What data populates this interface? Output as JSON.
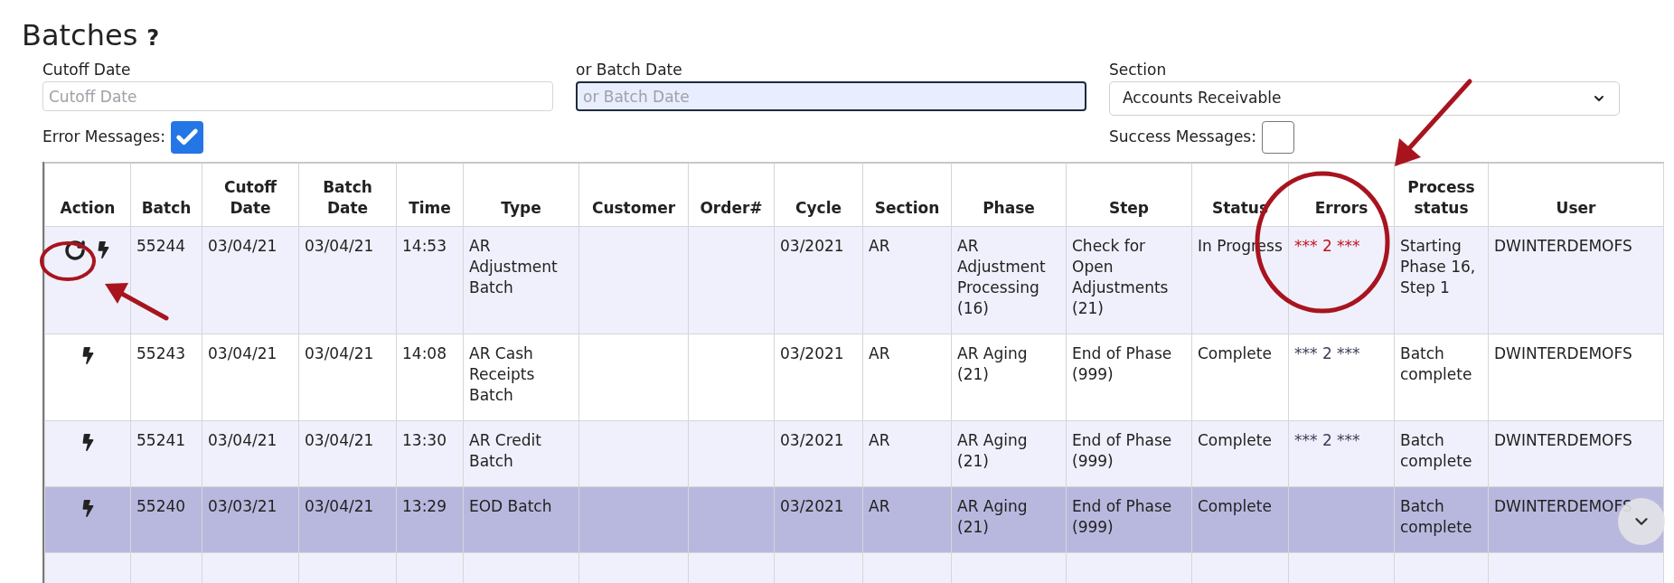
{
  "page": {
    "title": "Batches",
    "help": "?"
  },
  "filters": [
    {
      "kind": "date",
      "label": "Cutoff Date",
      "placeholder": "Cutoff Date",
      "focused": false
    },
    {
      "kind": "date",
      "label": "or Batch Date",
      "placeholder": "or Batch Date",
      "focused": true
    },
    {
      "kind": "select",
      "label": "Section",
      "value": "Accounts Receivable"
    }
  ],
  "options": [
    {
      "label": "Error Messages:",
      "checked": true
    },
    {
      "label": "Success Messages:",
      "checked": false
    }
  ],
  "table": {
    "columns": [
      "Action",
      "Batch",
      "Cutoff Date",
      "Batch Date",
      "Time",
      "Type",
      "Customer",
      "Order#",
      "Cycle",
      "Section",
      "Phase",
      "Step",
      "Status",
      "Errors",
      "Process status",
      "User"
    ],
    "rows": [
      {
        "selected": false,
        "actions": [
          {
            "kind": "refresh"
          },
          {
            "kind": "run"
          }
        ],
        "color": "#c0141c",
        "cells": [
          "",
          "55244",
          "03/04/21",
          "03/04/21",
          "14:53",
          "AR Adjustment Batch",
          "",
          "",
          "03/2021",
          "AR",
          "AR Adjustment Processing (16)",
          "Check for Open Adjustments (21)",
          "In Progress",
          "*** 2 ***",
          "Starting Phase 16, Step 1",
          "DWINTERDEMOFS"
        ]
      },
      {
        "selected": false,
        "actions": [
          {
            "kind": "run"
          }
        ],
        "color": "#3a3f55",
        "cells": [
          "",
          "55243",
          "03/04/21",
          "03/04/21",
          "14:08",
          "AR Cash Receipts Batch",
          "",
          "",
          "03/2021",
          "AR",
          "AR Aging (21)",
          "End of Phase (999)",
          "Complete",
          "*** 2 ***",
          "Batch complete",
          "DWINTERDEMOFS"
        ]
      },
      {
        "selected": false,
        "actions": [
          {
            "kind": "run"
          }
        ],
        "color": "#3a3f55",
        "cells": [
          "",
          "55241",
          "03/04/21",
          "03/04/21",
          "13:30",
          "AR Credit Batch",
          "",
          "",
          "03/2021",
          "AR",
          "AR Aging (21)",
          "End of Phase (999)",
          "Complete",
          "*** 2 ***",
          "Batch complete",
          "DWINTERDEMOFS"
        ]
      },
      {
        "selected": true,
        "actions": [
          {
            "kind": "run"
          }
        ],
        "cells": [
          "",
          "55240",
          "03/03/21",
          "03/04/21",
          "13:29",
          "EOD Batch",
          "",
          "",
          "03/2021",
          "AR",
          "AR Aging (21)",
          "End of Phase (999)",
          "Complete",
          "",
          "Batch complete",
          "DWINTERDEMOFS"
        ]
      }
    ]
  }
}
